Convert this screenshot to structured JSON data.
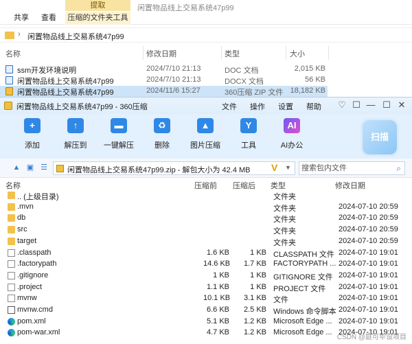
{
  "explorer": {
    "ribbon_tabs": [
      "共享",
      "查看"
    ],
    "context_header": "提取",
    "context_tab": "压缩的文件夹工具",
    "window_title": "闲置物品线上交易系统47p99",
    "address": "闲置物品线上交易系统47p99",
    "columns": {
      "name": "名称",
      "date": "修改日期",
      "type": "类型",
      "size": "大小"
    },
    "rows": [
      {
        "name": "ssm开发环境说明",
        "date": "2024/7/10 21:13",
        "type": "DOC 文档",
        "size": "2,015 KB"
      },
      {
        "name": "闲置物品线上交易系统47p99",
        "date": "2024/7/10 21:13",
        "type": "DOCX 文档",
        "size": "56 KB"
      },
      {
        "name": "闲置物品线上交易系统47p99",
        "date": "2024/11/6 15:27",
        "type": "360压缩 ZIP 文件",
        "size": "18,182 KB"
      }
    ]
  },
  "zip_window": {
    "title": "闲置物品线上交易系统47p99 - 360压缩",
    "menus": [
      "文件",
      "操作",
      "设置",
      "帮助"
    ],
    "tools": [
      "添加",
      "解压到",
      "一键解压",
      "删除",
      "图片压缩",
      "工具",
      "AI办公"
    ],
    "tool_glyphs": [
      "+",
      "↑",
      "▬",
      "♻",
      "▲",
      "Y",
      "AI"
    ],
    "extract_badge": "扫描",
    "path": "闲置物品线上交易系统47p99.zip - 解包大小为 42.4 MB",
    "search_placeholder": "搜索包内文件",
    "columns": {
      "name": "名称",
      "compressed": "压缩前",
      "uncompressed": "压缩后",
      "type": "类型",
      "modified": "修改日期"
    },
    "rows": [
      {
        "icon": "folder",
        "name": ".. (上级目录)",
        "c": "",
        "u": "",
        "type": "文件夹",
        "modified": ""
      },
      {
        "icon": "folder",
        "name": ".mvn",
        "c": "",
        "u": "",
        "type": "文件夹",
        "modified": "2024-07-10 20:59"
      },
      {
        "icon": "folder",
        "name": "db",
        "c": "",
        "u": "",
        "type": "文件夹",
        "modified": "2024-07-10 20:59"
      },
      {
        "icon": "folder",
        "name": "src",
        "c": "",
        "u": "",
        "type": "文件夹",
        "modified": "2024-07-10 20:59"
      },
      {
        "icon": "folder",
        "name": "target",
        "c": "",
        "u": "",
        "type": "文件夹",
        "modified": "2024-07-10 20:59"
      },
      {
        "icon": "file",
        "name": ".classpath",
        "c": "1.6 KB",
        "u": "1 KB",
        "type": "CLASSPATH 文件",
        "modified": "2024-07-10 19:01"
      },
      {
        "icon": "file",
        "name": ".factorypath",
        "c": "14.6 KB",
        "u": "1.7 KB",
        "type": "FACTORYPATH ...",
        "modified": "2024-07-10 19:01"
      },
      {
        "icon": "file",
        "name": ".gitignore",
        "c": "1 KB",
        "u": "1 KB",
        "type": "GITIGNORE 文件",
        "modified": "2024-07-10 19:01"
      },
      {
        "icon": "file",
        "name": ".project",
        "c": "1.1 KB",
        "u": "1 KB",
        "type": "PROJECT 文件",
        "modified": "2024-07-10 19:01"
      },
      {
        "icon": "file",
        "name": "mvnw",
        "c": "10.1 KB",
        "u": "3.1 KB",
        "type": "文件",
        "modified": "2024-07-10 19:01"
      },
      {
        "icon": "cmd",
        "name": "mvnw.cmd",
        "c": "6.6 KB",
        "u": "2.5 KB",
        "type": "Windows 命令脚本",
        "modified": "2024-07-10 19:01"
      },
      {
        "icon": "edge",
        "name": "pom.xml",
        "c": "5.1 KB",
        "u": "1.2 KB",
        "type": "Microsoft Edge ...",
        "modified": "2024-07-10 19:01"
      },
      {
        "icon": "edge",
        "name": "pom-war.xml",
        "c": "4.7 KB",
        "u": "1.2 KB",
        "type": "Microsoft Edge ...",
        "modified": "2024-07-10 19:01"
      }
    ]
  },
  "watermark": "CSDN @庭可毕设项目"
}
